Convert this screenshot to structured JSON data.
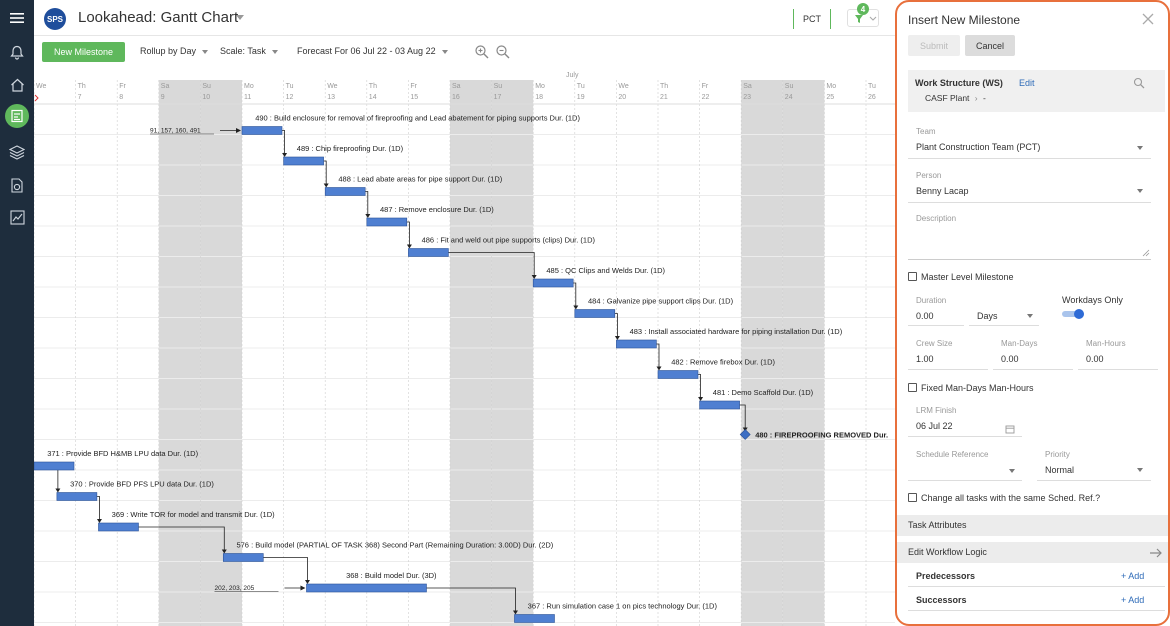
{
  "app": {
    "logo": "SPS",
    "title": "Lookahead: Gantt Chart",
    "team_code": "PCT",
    "filter_count": "4"
  },
  "toolbar": {
    "new_milestone": "New Milestone",
    "rollup": "Rollup by Day",
    "scale": "Scale: Task",
    "forecast": "Forecast For 06 Jul 22 - 03 Aug 22"
  },
  "timeline": {
    "month": "July",
    "days": [
      {
        "dow": "We",
        "num": "",
        "weekend": false
      },
      {
        "dow": "Th",
        "num": "7",
        "weekend": false
      },
      {
        "dow": "Fr",
        "num": "8",
        "weekend": false
      },
      {
        "dow": "Sa",
        "num": "9",
        "weekend": true
      },
      {
        "dow": "Su",
        "num": "10",
        "weekend": true
      },
      {
        "dow": "Mo",
        "num": "11",
        "weekend": false
      },
      {
        "dow": "Tu",
        "num": "12",
        "weekend": false
      },
      {
        "dow": "We",
        "num": "13",
        "weekend": false
      },
      {
        "dow": "Th",
        "num": "14",
        "weekend": false
      },
      {
        "dow": "Fr",
        "num": "15",
        "weekend": false
      },
      {
        "dow": "Sa",
        "num": "16",
        "weekend": true
      },
      {
        "dow": "Su",
        "num": "17",
        "weekend": true
      },
      {
        "dow": "Mo",
        "num": "18",
        "weekend": false
      },
      {
        "dow": "Tu",
        "num": "19",
        "weekend": false
      },
      {
        "dow": "We",
        "num": "20",
        "weekend": false
      },
      {
        "dow": "Th",
        "num": "21",
        "weekend": false
      },
      {
        "dow": "Fr",
        "num": "22",
        "weekend": false
      },
      {
        "dow": "Sa",
        "num": "23",
        "weekend": true
      },
      {
        "dow": "Su",
        "num": "24",
        "weekend": true
      },
      {
        "dow": "Mo",
        "num": "25",
        "weekend": false
      },
      {
        "dow": "Tu",
        "num": "26",
        "weekend": false
      }
    ]
  },
  "tasks": [
    {
      "row": 0,
      "start": 5,
      "label": "490 : Build enclosure for removal of fireproofing and Lead abatement for piping supports Dur. (1D)",
      "pred": "91, 157, 160, 491"
    },
    {
      "row": 1,
      "start": 6,
      "label": "489 : Chip fireproofing Dur. (1D)"
    },
    {
      "row": 2,
      "start": 7,
      "label": "488 : Lead abate areas for pipe support Dur. (1D)"
    },
    {
      "row": 3,
      "start": 8,
      "label": "487 : Remove enclosure Dur. (1D)"
    },
    {
      "row": 4,
      "start": 9,
      "label": "486 : Fit and weld out pipe supports (clips) Dur. (1D)"
    },
    {
      "row": 5,
      "start": 12,
      "label": "485 : QC Clips and Welds Dur. (1D)"
    },
    {
      "row": 6,
      "start": 13,
      "label": "484 : Galvanize pipe support clips Dur. (1D)"
    },
    {
      "row": 7,
      "start": 14,
      "label": "483 : Install associated hardware for piping installation Dur. (1D)"
    },
    {
      "row": 8,
      "start": 15,
      "label": "482 : Remove firebox Dur. (1D)"
    },
    {
      "row": 9,
      "start": 16,
      "label": "481 : Demo Scaffold Dur. (1D)"
    },
    {
      "row": 10,
      "start": 17,
      "label": "480 : FIREPROOFING REMOVED Dur.",
      "milestone": true
    },
    {
      "row": 11,
      "start": 0,
      "label": "371 : Provide BFD H&MB LPU data Dur. (1D)"
    },
    {
      "row": 12,
      "start": 0.55,
      "label": "370 : Provide BFD PFS LPU data Dur. (1D)"
    },
    {
      "row": 13,
      "start": 1.55,
      "label": "369 : Write TOR for model and transmit Dur. (1D)"
    },
    {
      "row": 14,
      "start": 4.55,
      "label": "576 : Build model (PARTIAL OF TASK 368) Second Part (Remaining Duration: 3.00D) Dur. (2D)"
    },
    {
      "row": 15,
      "start": 6.55,
      "label": "368 : Build model Dur. (3D)",
      "pred": "202, 203, 205",
      "dur": 3
    },
    {
      "row": 16,
      "start": 11.55,
      "label": "367 : Run simulation case 1 on pics technology Dur. (1D)"
    }
  ],
  "panel": {
    "title": "Insert New Milestone",
    "submit": "Submit",
    "cancel": "Cancel",
    "ws_label": "Work Structure (WS)",
    "ws_edit": "Edit",
    "ws_path1": "CASF Plant",
    "ws_path2": "-",
    "team_label": "Team",
    "team_value": "Plant Construction Team (PCT)",
    "person_label": "Person",
    "person_value": "Benny Lacap",
    "desc_label": "Description",
    "master_label": "Master Level Milestone",
    "duration_label": "Duration",
    "duration_value": "0.00",
    "units_value": "Days",
    "workdays_label": "Workdays Only",
    "crew_label": "Crew Size",
    "crew_value": "1.00",
    "mandays_label": "Man-Days",
    "mandays_value": "0.00",
    "manhours_label": "Man-Hours",
    "manhours_value": "0.00",
    "fixed_label": "Fixed Man-Days Man-Hours",
    "lrm_label": "LRM Finish",
    "lrm_value": "06 Jul 22",
    "sched_label": "Schedule Reference",
    "priority_label": "Priority",
    "priority_value": "Normal",
    "change_label": "Change all tasks with the same Sched. Ref.?",
    "task_attr": "Task Attributes",
    "workflow": "Edit Workflow Logic",
    "predecessors": "Predecessors",
    "successors": "Successors",
    "add": "+ Add"
  }
}
